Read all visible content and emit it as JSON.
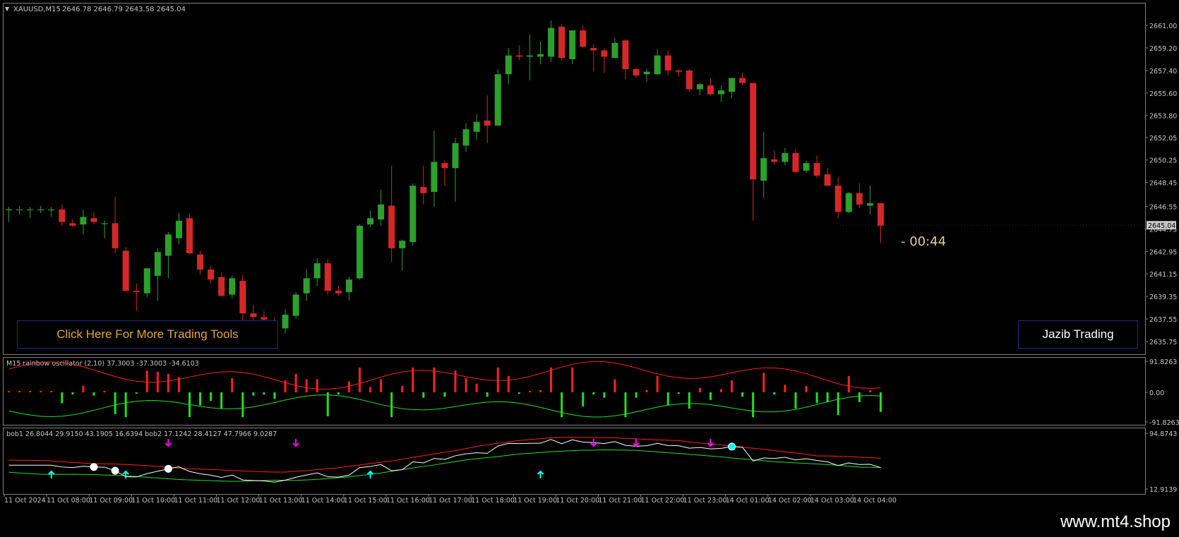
{
  "symbol_header": {
    "caret": "▼",
    "symbol": "XAUUSD,M15",
    "ohlc": "2646.78 2646.79 2643.58 2645.04"
  },
  "countdown": "- 00:44",
  "buttons": {
    "more_tools": "Click Here For More Trading Tools",
    "brand": "Jazib Trading"
  },
  "watermark": "www.mt4.shop",
  "colors": {
    "bull": "#2ca02c",
    "bear": "#d62728",
    "axis": "#c8c8c8",
    "frame": "#808080",
    "osc_red": "#ff2020",
    "osc_green": "#20e020",
    "signal_up": "#00ffff",
    "signal_down": "#ff00ff"
  },
  "price_axis": {
    "ticks": [
      "2661.00",
      "2659.20",
      "2657.40",
      "2655.60",
      "2653.80",
      "2652.05",
      "2650.25",
      "2648.45",
      "2646.55",
      "2644.75",
      "2642.95",
      "2641.15",
      "2639.35",
      "2637.55",
      "2635.75"
    ],
    "current": "2645.04"
  },
  "oscillator_panel": {
    "title": "M15 rainbow oscillator (2,10) 37.3003 -37.3003 -34.6103",
    "ticks": [
      "91.8263",
      "0.00",
      "-91.8263"
    ]
  },
  "bob_panel": {
    "title": "bob1 26.8044 29.9150 43.1905 16.6394  bob2 17.1242 28.4127 47.7966 9.0287",
    "ticks": [
      "94.8743",
      "12.9139"
    ]
  },
  "time_axis": [
    "11 Oct 2024",
    "11 Oct 08:00",
    "11 Oct 09:00",
    "11 Oct 10:00",
    "11 Oct 11:00",
    "11 Oct 12:00",
    "11 Oct 13:00",
    "11 Oct 14:00",
    "11 Oct 15:00",
    "11 Oct 16:00",
    "11 Oct 17:00",
    "11 Oct 18:00",
    "11 Oct 19:00",
    "11 Oct 20:00",
    "11 Oct 21:00",
    "11 Oct 22:00",
    "11 Oct 23:00",
    "14 Oct 01:00",
    "14 Oct 02:00",
    "14 Oct 03:00",
    "14 Oct 04:00"
  ],
  "chart_data": {
    "type": "candlestick",
    "title": "XAUUSD,M15",
    "ylim": [
      2635.3,
      2661.9
    ],
    "candles": [
      {
        "o": 2646.3,
        "h": 2646.5,
        "l": 2645.3,
        "c": 2646.3
      },
      {
        "o": 2646.3,
        "h": 2646.6,
        "l": 2645.9,
        "c": 2646.3
      },
      {
        "o": 2646.3,
        "h": 2646.5,
        "l": 2645.6,
        "c": 2646.3
      },
      {
        "o": 2646.3,
        "h": 2646.6,
        "l": 2646.0,
        "c": 2646.3
      },
      {
        "o": 2646.3,
        "h": 2646.5,
        "l": 2645.7,
        "c": 2646.3
      },
      {
        "o": 2646.3,
        "h": 2646.7,
        "l": 2645.0,
        "c": 2645.3
      },
      {
        "o": 2645.2,
        "h": 2645.5,
        "l": 2644.9,
        "c": 2645.0
      },
      {
        "o": 2645.1,
        "h": 2646.3,
        "l": 2644.3,
        "c": 2645.7
      },
      {
        "o": 2645.6,
        "h": 2646.1,
        "l": 2645.1,
        "c": 2645.3
      },
      {
        "o": 2645.2,
        "h": 2645.4,
        "l": 2644.0,
        "c": 2645.2
      },
      {
        "o": 2645.2,
        "h": 2647.3,
        "l": 2642.8,
        "c": 2643.2
      },
      {
        "o": 2643.0,
        "h": 2643.3,
        "l": 2639.7,
        "c": 2639.8
      },
      {
        "o": 2639.8,
        "h": 2640.4,
        "l": 2638.2,
        "c": 2639.7
      },
      {
        "o": 2639.6,
        "h": 2641.6,
        "l": 2639.3,
        "c": 2641.6
      },
      {
        "o": 2641.0,
        "h": 2643.2,
        "l": 2639.0,
        "c": 2642.9
      },
      {
        "o": 2642.6,
        "h": 2644.5,
        "l": 2640.8,
        "c": 2644.3
      },
      {
        "o": 2644.0,
        "h": 2646.0,
        "l": 2643.5,
        "c": 2645.4
      },
      {
        "o": 2645.6,
        "h": 2646.0,
        "l": 2642.7,
        "c": 2642.8
      },
      {
        "o": 2642.7,
        "h": 2643.0,
        "l": 2641.1,
        "c": 2641.5
      },
      {
        "o": 2641.5,
        "h": 2641.8,
        "l": 2640.4,
        "c": 2640.7
      },
      {
        "o": 2640.9,
        "h": 2641.3,
        "l": 2639.3,
        "c": 2639.4
      },
      {
        "o": 2639.5,
        "h": 2641.0,
        "l": 2639.2,
        "c": 2640.8
      },
      {
        "o": 2640.6,
        "h": 2641.1,
        "l": 2637.3,
        "c": 2638.0
      },
      {
        "o": 2638.0,
        "h": 2638.7,
        "l": 2636.6,
        "c": 2637.7
      },
      {
        "o": 2637.7,
        "h": 2638.2,
        "l": 2636.9,
        "c": 2637.5
      },
      {
        "o": 2637.4,
        "h": 2637.7,
        "l": 2636.6,
        "c": 2636.8
      },
      {
        "o": 2636.8,
        "h": 2638.3,
        "l": 2636.4,
        "c": 2637.9
      },
      {
        "o": 2637.8,
        "h": 2639.7,
        "l": 2637.6,
        "c": 2639.5
      },
      {
        "o": 2639.6,
        "h": 2641.5,
        "l": 2639.0,
        "c": 2640.8
      },
      {
        "o": 2640.8,
        "h": 2642.4,
        "l": 2640.2,
        "c": 2642.0
      },
      {
        "o": 2642.0,
        "h": 2642.3,
        "l": 2639.5,
        "c": 2639.8
      },
      {
        "o": 2639.8,
        "h": 2640.2,
        "l": 2639.4,
        "c": 2639.6
      },
      {
        "o": 2639.7,
        "h": 2640.9,
        "l": 2639.0,
        "c": 2640.7
      },
      {
        "o": 2640.8,
        "h": 2645.1,
        "l": 2640.7,
        "c": 2645.0
      },
      {
        "o": 2645.1,
        "h": 2646.2,
        "l": 2644.9,
        "c": 2645.6
      },
      {
        "o": 2645.5,
        "h": 2647.9,
        "l": 2645.0,
        "c": 2646.7
      },
      {
        "o": 2646.6,
        "h": 2649.8,
        "l": 2642.1,
        "c": 2643.2
      },
      {
        "o": 2643.2,
        "h": 2643.9,
        "l": 2641.4,
        "c": 2643.8
      },
      {
        "o": 2643.7,
        "h": 2648.4,
        "l": 2643.4,
        "c": 2648.2
      },
      {
        "o": 2648.1,
        "h": 2649.8,
        "l": 2646.7,
        "c": 2647.6
      },
      {
        "o": 2647.7,
        "h": 2652.6,
        "l": 2646.5,
        "c": 2650.1
      },
      {
        "o": 2650.0,
        "h": 2650.2,
        "l": 2648.2,
        "c": 2649.6
      },
      {
        "o": 2649.6,
        "h": 2652.0,
        "l": 2646.9,
        "c": 2651.6
      },
      {
        "o": 2651.4,
        "h": 2653.2,
        "l": 2650.9,
        "c": 2652.7
      },
      {
        "o": 2652.5,
        "h": 2653.9,
        "l": 2651.9,
        "c": 2653.3
      },
      {
        "o": 2653.4,
        "h": 2655.4,
        "l": 2651.6,
        "c": 2653.0
      },
      {
        "o": 2653.0,
        "h": 2657.5,
        "l": 2653.0,
        "c": 2657.1
      },
      {
        "o": 2657.1,
        "h": 2659.2,
        "l": 2656.3,
        "c": 2658.6
      },
      {
        "o": 2658.6,
        "h": 2659.4,
        "l": 2658.2,
        "c": 2658.5
      },
      {
        "o": 2658.5,
        "h": 2660.3,
        "l": 2656.6,
        "c": 2658.6
      },
      {
        "o": 2658.5,
        "h": 2659.7,
        "l": 2657.9,
        "c": 2658.7
      },
      {
        "o": 2658.5,
        "h": 2661.4,
        "l": 2658.1,
        "c": 2660.8
      },
      {
        "o": 2660.9,
        "h": 2661.1,
        "l": 2658.2,
        "c": 2658.4
      },
      {
        "o": 2658.3,
        "h": 2660.5,
        "l": 2657.9,
        "c": 2660.6
      },
      {
        "o": 2660.6,
        "h": 2661.0,
        "l": 2659.2,
        "c": 2659.3
      },
      {
        "o": 2659.2,
        "h": 2659.5,
        "l": 2657.3,
        "c": 2659.0
      },
      {
        "o": 2659.0,
        "h": 2659.2,
        "l": 2657.2,
        "c": 2658.5
      },
      {
        "o": 2658.4,
        "h": 2660.0,
        "l": 2658.4,
        "c": 2659.6
      },
      {
        "o": 2659.8,
        "h": 2659.9,
        "l": 2656.7,
        "c": 2657.5
      },
      {
        "o": 2657.5,
        "h": 2657.6,
        "l": 2656.8,
        "c": 2657.0
      },
      {
        "o": 2657.1,
        "h": 2657.5,
        "l": 2656.5,
        "c": 2657.3
      },
      {
        "o": 2657.1,
        "h": 2659.1,
        "l": 2657.0,
        "c": 2658.6
      },
      {
        "o": 2658.6,
        "h": 2659.0,
        "l": 2657.0,
        "c": 2657.4
      },
      {
        "o": 2657.4,
        "h": 2657.5,
        "l": 2656.9,
        "c": 2657.3
      },
      {
        "o": 2657.4,
        "h": 2657.5,
        "l": 2655.7,
        "c": 2655.9
      },
      {
        "o": 2655.9,
        "h": 2656.4,
        "l": 2655.4,
        "c": 2656.3
      },
      {
        "o": 2656.2,
        "h": 2656.8,
        "l": 2655.4,
        "c": 2655.5
      },
      {
        "o": 2655.5,
        "h": 2656.2,
        "l": 2654.9,
        "c": 2655.8
      },
      {
        "o": 2655.7,
        "h": 2656.8,
        "l": 2655.2,
        "c": 2656.8
      },
      {
        "o": 2656.8,
        "h": 2657.2,
        "l": 2656.2,
        "c": 2656.4
      },
      {
        "o": 2656.4,
        "h": 2656.4,
        "l": 2645.4,
        "c": 2648.7
      },
      {
        "o": 2648.6,
        "h": 2652.5,
        "l": 2647.2,
        "c": 2650.4
      },
      {
        "o": 2650.3,
        "h": 2651.0,
        "l": 2649.9,
        "c": 2650.1
      },
      {
        "o": 2650.1,
        "h": 2651.2,
        "l": 2649.8,
        "c": 2650.8
      },
      {
        "o": 2650.8,
        "h": 2651.1,
        "l": 2649.2,
        "c": 2649.3
      },
      {
        "o": 2649.4,
        "h": 2650.2,
        "l": 2649.2,
        "c": 2650.0
      },
      {
        "o": 2650.0,
        "h": 2650.6,
        "l": 2648.8,
        "c": 2649.0
      },
      {
        "o": 2649.1,
        "h": 2649.6,
        "l": 2648.2,
        "c": 2648.2
      },
      {
        "o": 2648.2,
        "h": 2648.9,
        "l": 2645.6,
        "c": 2646.1
      },
      {
        "o": 2646.1,
        "h": 2647.7,
        "l": 2646.0,
        "c": 2647.6
      },
      {
        "o": 2647.6,
        "h": 2648.4,
        "l": 2646.4,
        "c": 2646.7
      },
      {
        "o": 2646.6,
        "h": 2648.2,
        "l": 2645.9,
        "c": 2646.8
      },
      {
        "o": 2646.8,
        "h": 2646.8,
        "l": 2643.6,
        "c": 2645.0
      }
    ]
  }
}
